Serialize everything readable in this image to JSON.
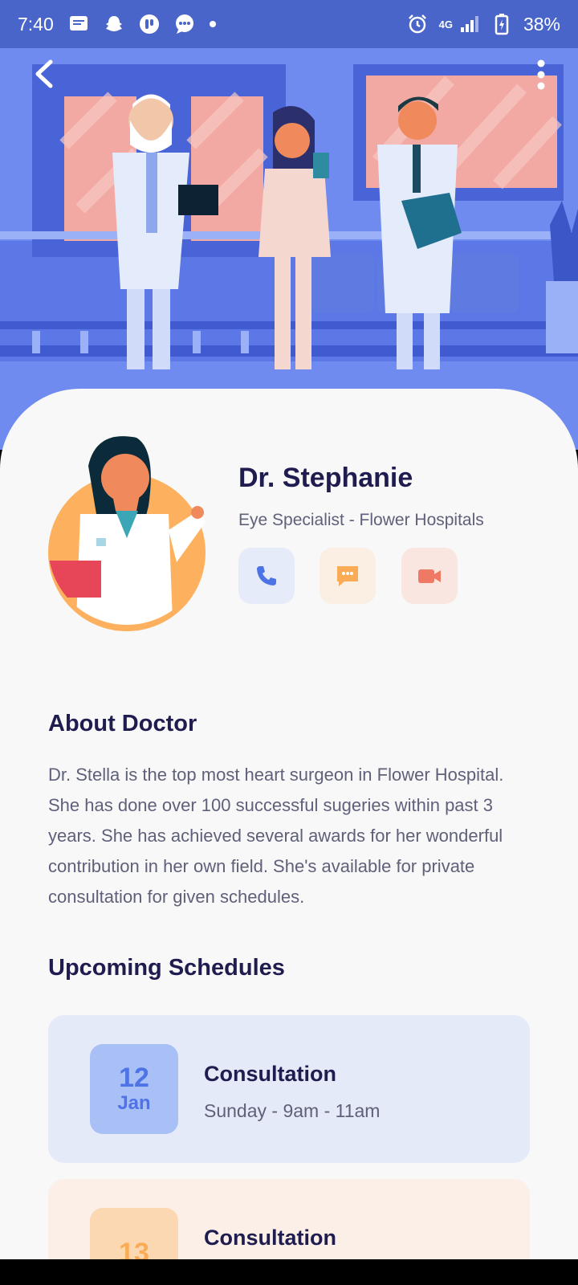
{
  "status_bar": {
    "time": "7:40",
    "network": "4G",
    "battery": "38%",
    "icons": [
      "messages-icon",
      "snapchat-icon",
      "app-icon",
      "chat-bubble-icon",
      "dot-icon",
      "alarm-icon",
      "signal-icon",
      "battery-charging-icon"
    ]
  },
  "header": {
    "back_icon": "chevron-left-icon",
    "more_icon": "more-vertical-icon",
    "illustration": "doctors-hospital-illustration"
  },
  "doctor": {
    "name": "Dr. Stephanie",
    "specialty": "Eye Specialist - Flower Hospitals",
    "avatar": "doctor-avatar-illustration",
    "actions": [
      {
        "icon": "phone-icon",
        "color": "#4d73e6"
      },
      {
        "icon": "message-icon",
        "color": "#f9ab55"
      },
      {
        "icon": "video-camera-icon",
        "color": "#ee7a66"
      }
    ]
  },
  "about": {
    "title": "About Doctor",
    "text": "Dr. Stella is the top most heart surgeon in Flower Hospital. She has done over 100 successful sugeries within past 3 years. She has achieved several awards for her wonderful contribution in her own field. She's available for private consultation for given schedules."
  },
  "schedules": {
    "title": "Upcoming Schedules",
    "items": [
      {
        "day": "12",
        "month": "Jan",
        "label": "Consultation",
        "time": "Sunday - 9am - 11am",
        "accent": "#4d73e6"
      },
      {
        "day": "13",
        "month": "",
        "label": "Consultation",
        "time": "",
        "accent": "#f9ab55"
      }
    ]
  },
  "colors": {
    "primary": "#4a65c9",
    "hero": "#6f8bf0",
    "heading": "#1f1d4f",
    "body_text": "#5f607a",
    "background": "#f8f8f8"
  }
}
